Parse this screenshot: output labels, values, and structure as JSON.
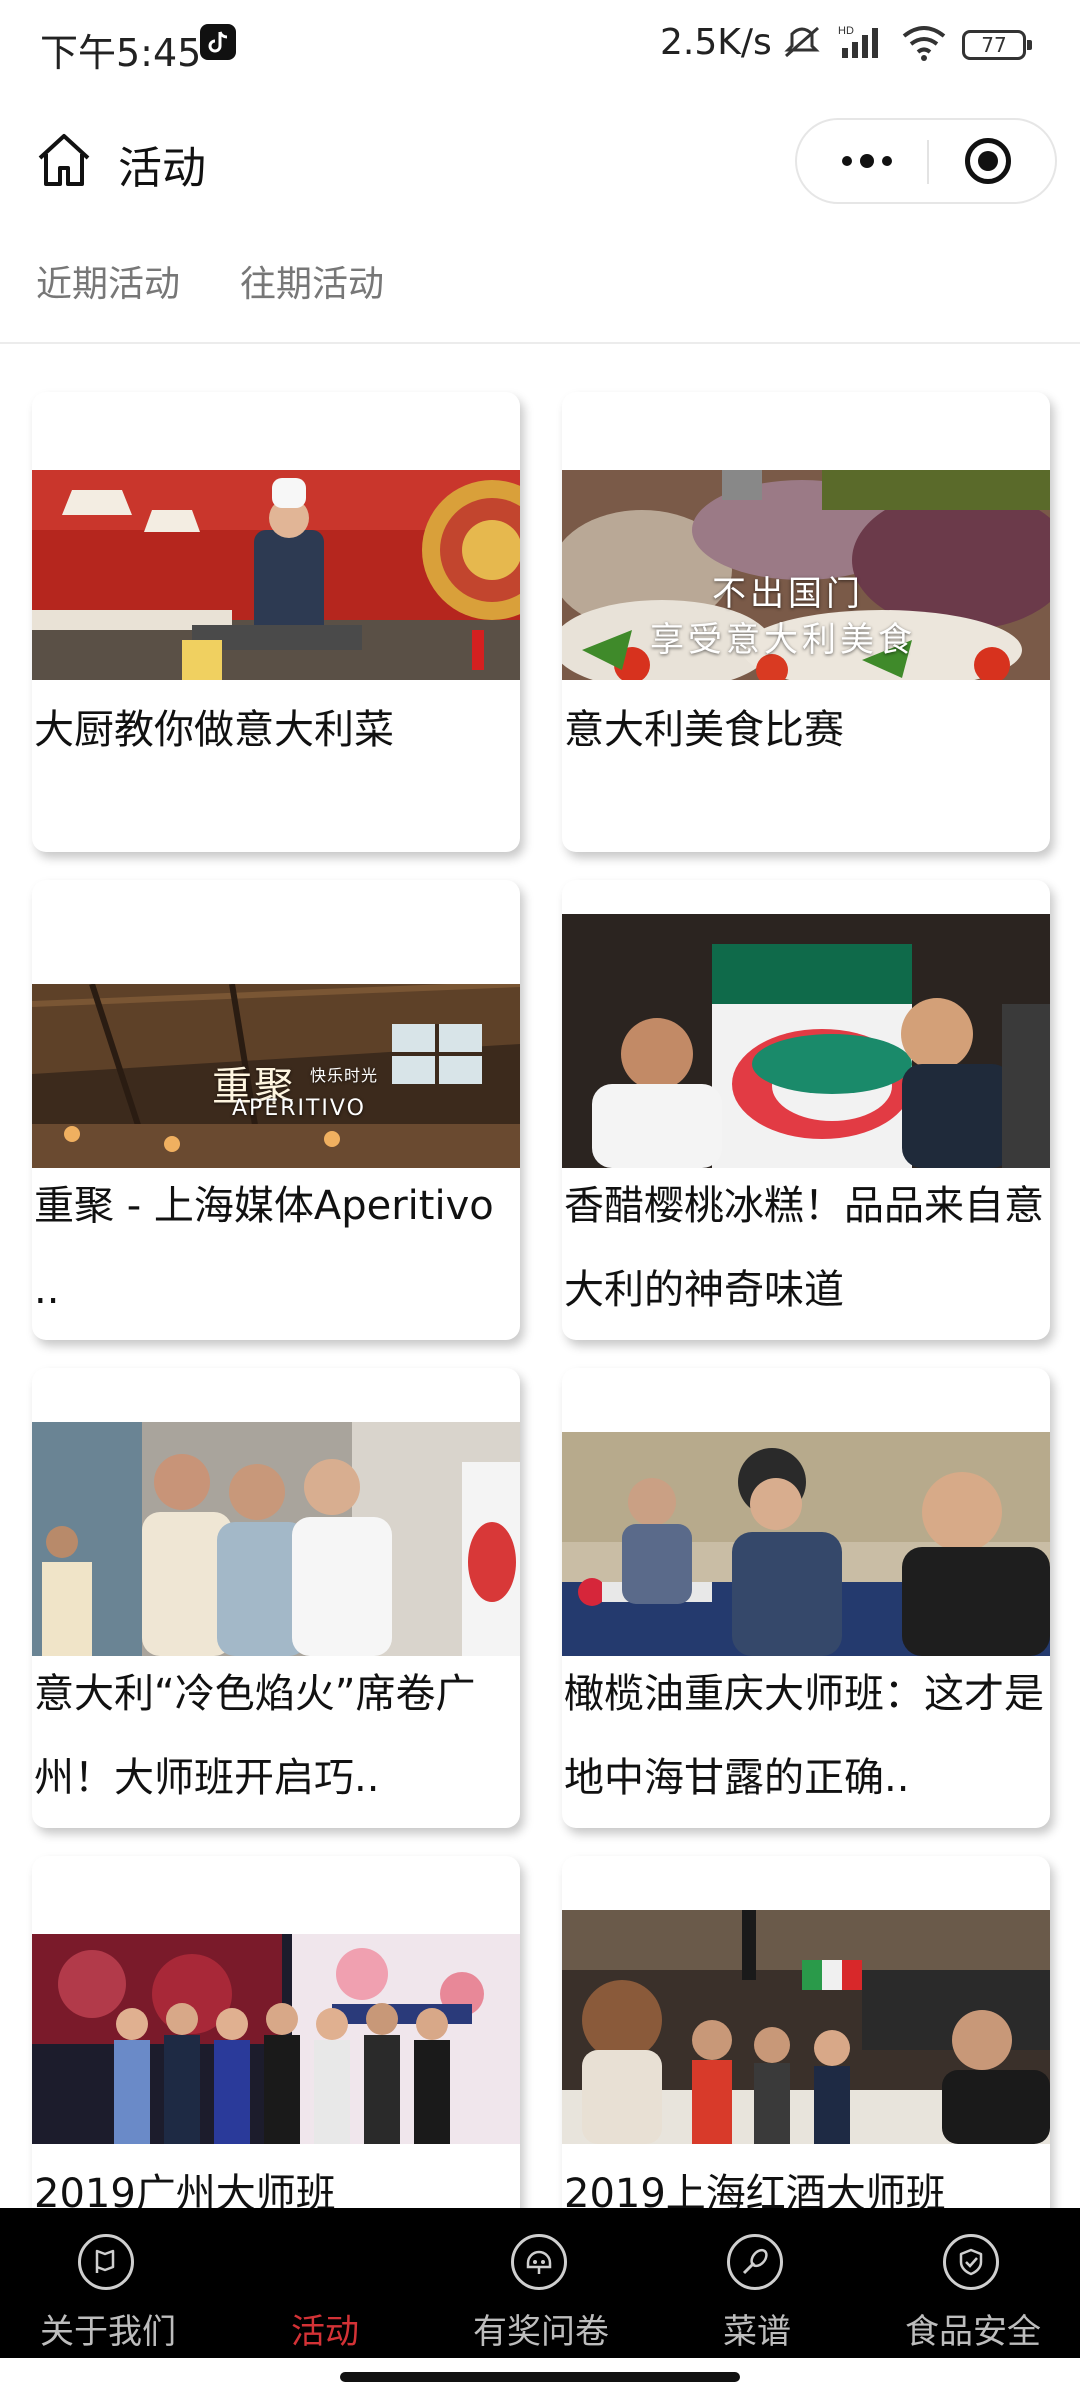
{
  "status_bar": {
    "time": "下午5:45",
    "net_speed": "2.5K/s",
    "battery": "77"
  },
  "nav": {
    "title": "活动"
  },
  "tabs": [
    {
      "label": "近期活动"
    },
    {
      "label": "往期活动"
    }
  ],
  "cards": [
    {
      "title": "大厨教你做意大利菜"
    },
    {
      "title": "意大利美食比赛",
      "overlay_line1": "不出国门",
      "overlay_line2": "享受意大利美食"
    },
    {
      "title": "重聚 - 上海媒体Aperitivo ..",
      "overlay_cn": "重聚",
      "overlay_sub": "快乐时光",
      "overlay_en": "APERITIVO"
    },
    {
      "title": "香醋樱桃冰糕！品品来自意大利的神奇味道"
    },
    {
      "title": "意大利“冷色焰火”席卷广州！大师班开启巧.."
    },
    {
      "title": "橄榄油重庆大师班：这才是地中海甘露的正确.."
    },
    {
      "title": "2019广州大师班"
    },
    {
      "title": "2019上海红酒大师班"
    }
  ],
  "tabbar": {
    "items": [
      {
        "label": "关于我们",
        "icon": "flag-icon"
      },
      {
        "label": "活动",
        "icon": "activity-icon"
      },
      {
        "label": "有奖问卷",
        "icon": "survey-icon"
      },
      {
        "label": "菜谱",
        "icon": "whisk-icon"
      },
      {
        "label": "食品安全",
        "icon": "shield-check-icon"
      }
    ],
    "active_index": 1,
    "active_color": "#d33236"
  }
}
